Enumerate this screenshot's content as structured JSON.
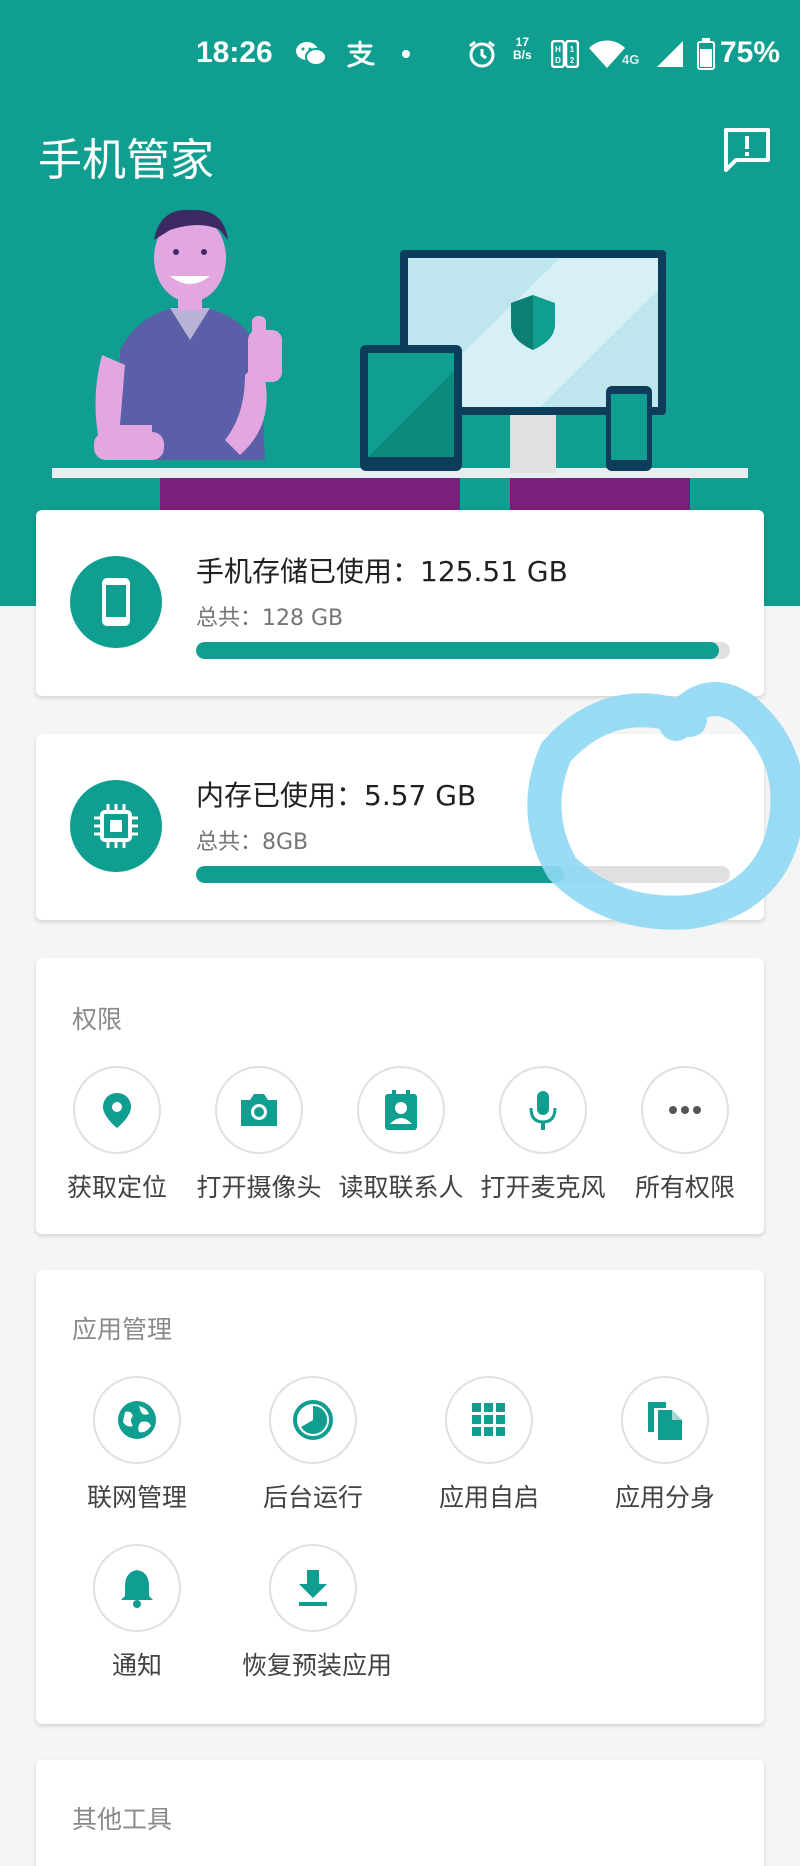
{
  "status_bar": {
    "time": "18:26",
    "net_speed_value": "17",
    "net_speed_unit": "B/s",
    "signal_label": "4G",
    "battery": "75%",
    "icons": [
      "wechat-icon",
      "alipay-icon",
      "dot-icon",
      "alarm-icon",
      "netspeed-icon",
      "hd-icon",
      "wifi-icon",
      "cell-signal-icon",
      "battery-icon"
    ]
  },
  "app_bar": {
    "title": "手机管家",
    "feedback_icon": "feedback-icon"
  },
  "storage": {
    "title": "手机存储已使用：125.51 GB",
    "total": "总共：128 GB",
    "used_fraction": 0.98,
    "icon": "phone-icon"
  },
  "memory": {
    "title": "内存已使用：5.57 GB",
    "total": "总共：8GB",
    "used_fraction": 0.69,
    "icon": "chip-icon"
  },
  "permissions": {
    "title": "权限",
    "items": [
      {
        "label": "获取定位",
        "icon": "location-pin-icon"
      },
      {
        "label": "打开摄像头",
        "icon": "camera-icon"
      },
      {
        "label": "读取联系人",
        "icon": "contact-card-icon"
      },
      {
        "label": "打开麦克风",
        "icon": "microphone-icon"
      },
      {
        "label": "所有权限",
        "icon": "more-dots-icon"
      }
    ]
  },
  "app_management": {
    "title": "应用管理",
    "items": [
      {
        "label": "联网管理",
        "icon": "globe-icon"
      },
      {
        "label": "后台运行",
        "icon": "pie-timer-icon"
      },
      {
        "label": "应用自启",
        "icon": "grid-icon"
      },
      {
        "label": "应用分身",
        "icon": "copy-icon"
      },
      {
        "label": "通知",
        "icon": "bell-icon"
      },
      {
        "label": "恢复预装应用",
        "icon": "download-icon"
      }
    ]
  },
  "other_tools": {
    "title": "其他工具"
  },
  "colors": {
    "teal": "#0f9e8f",
    "annotation_blue": "#8fd8f5"
  }
}
